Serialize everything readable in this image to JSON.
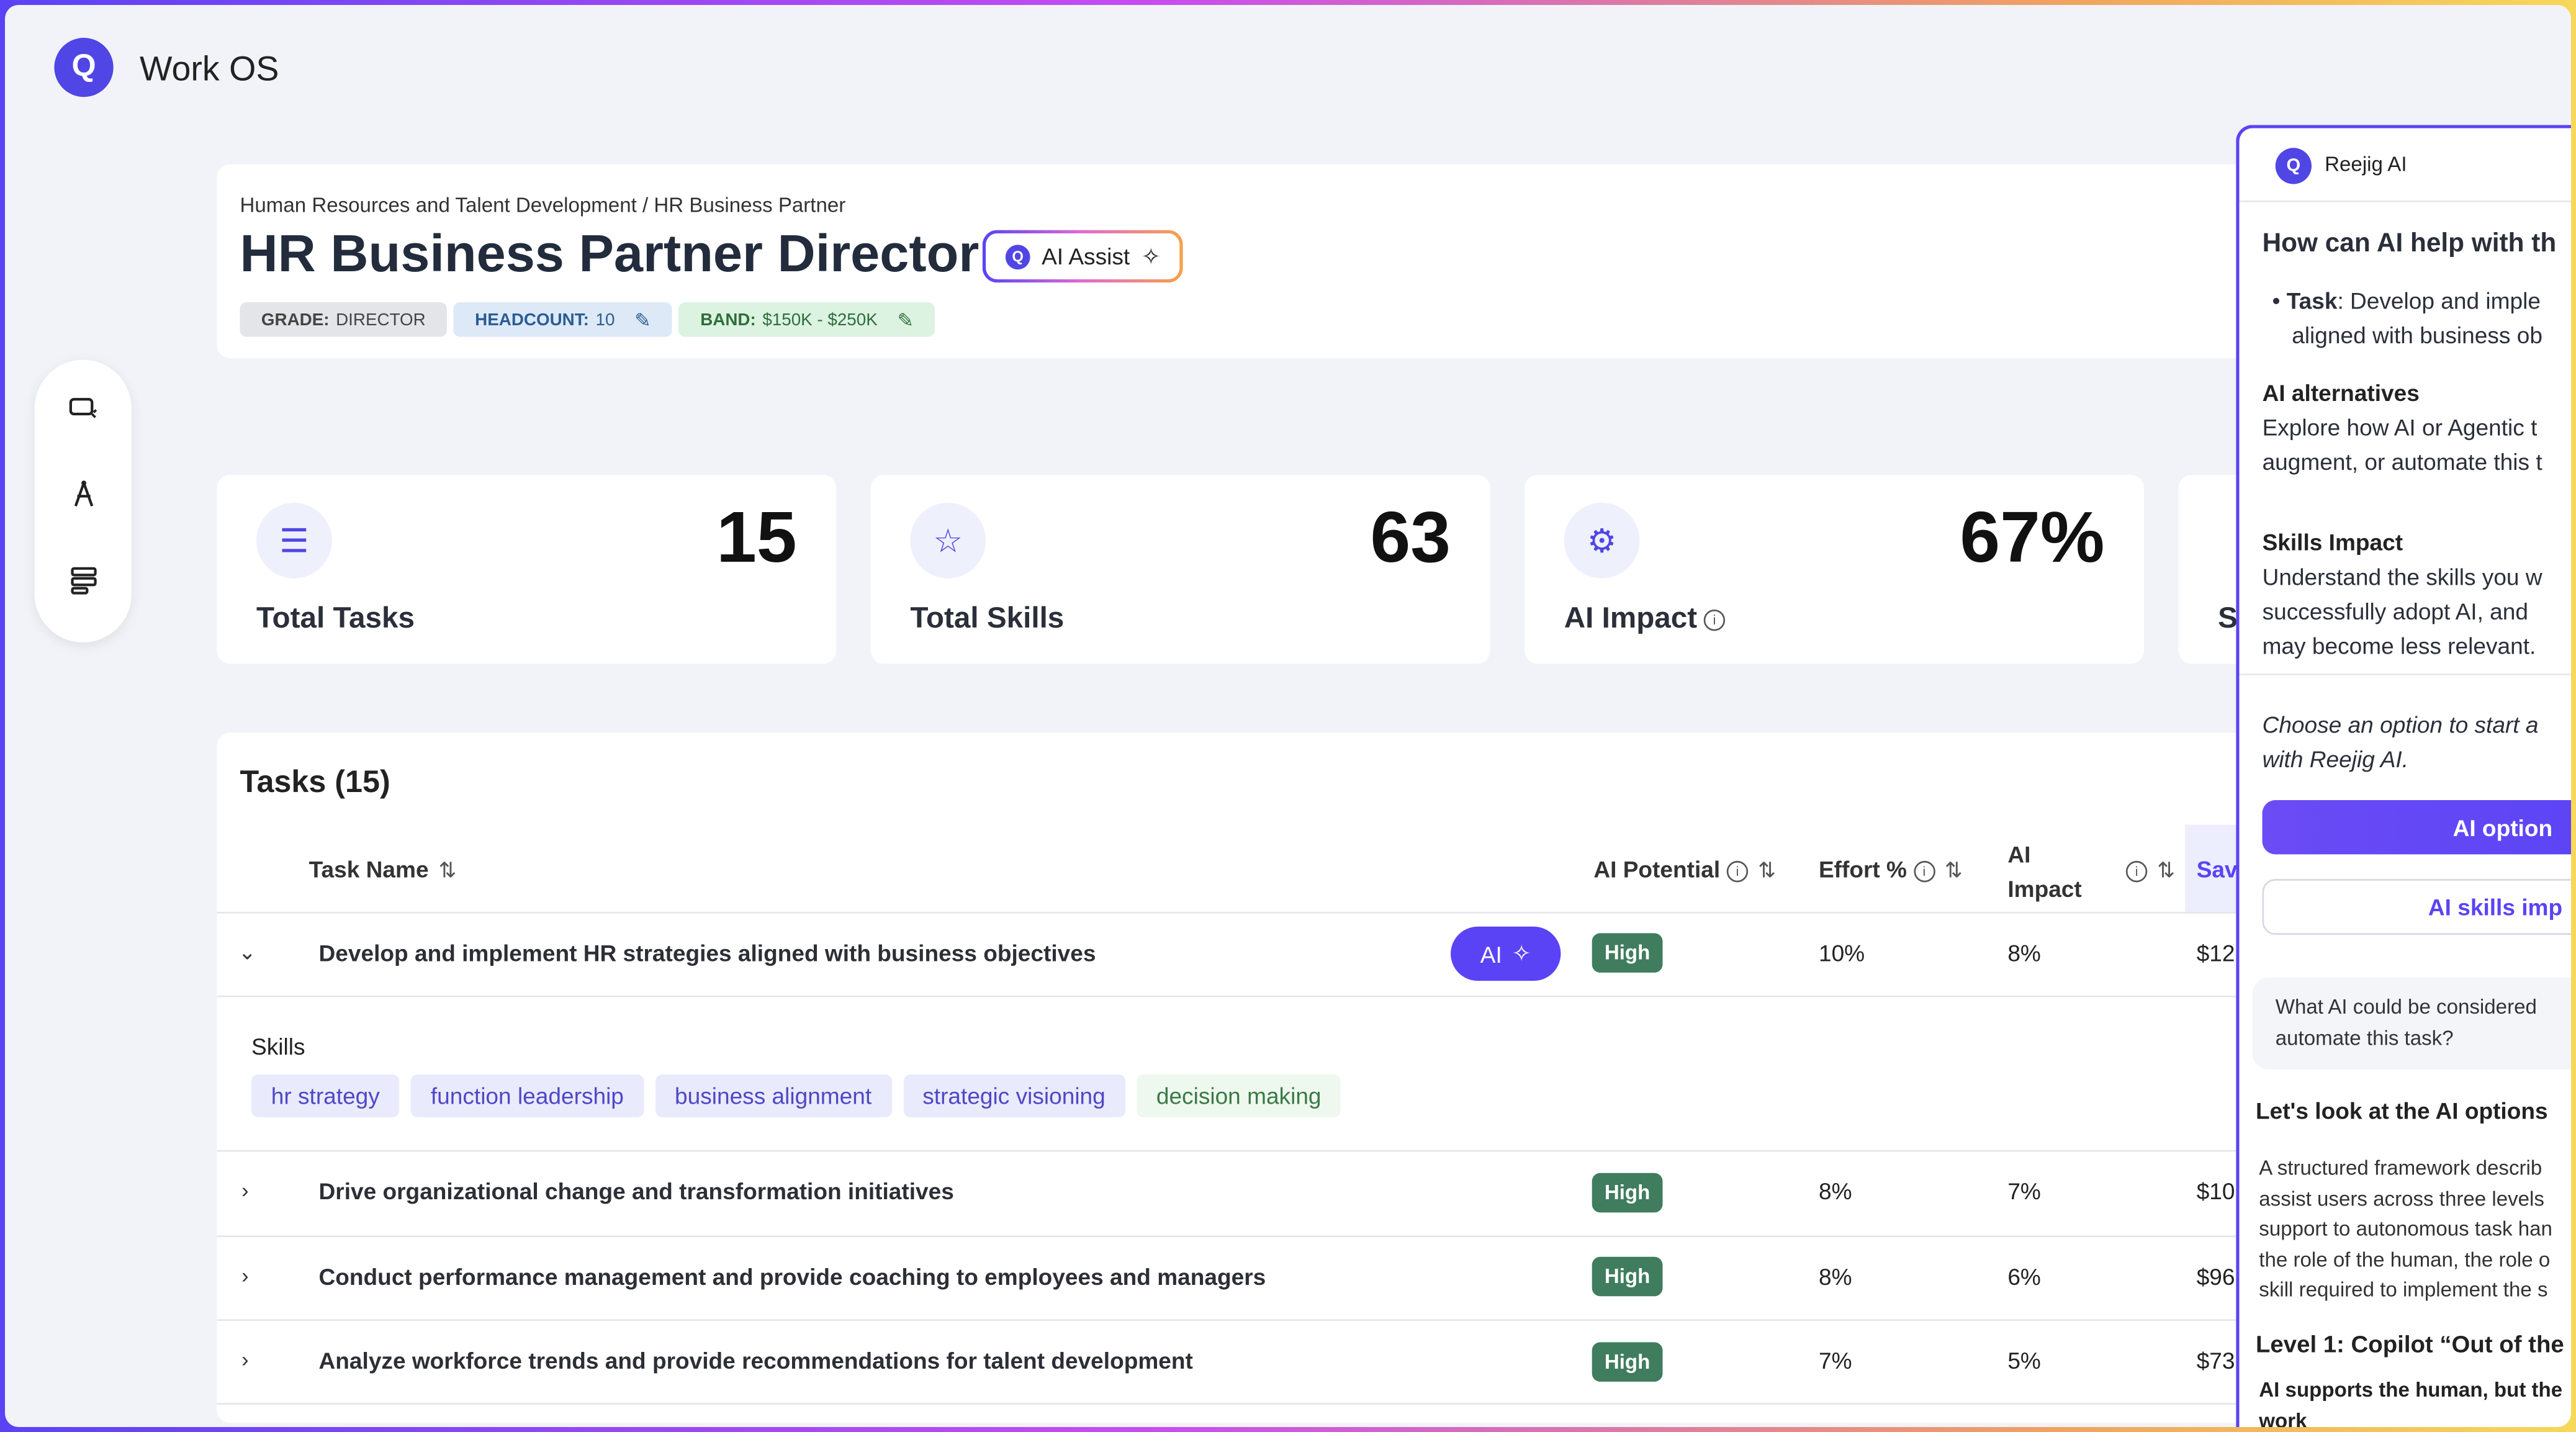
{
  "app": {
    "logo_letter": "Q",
    "name": "Work OS"
  },
  "dock": {
    "icons": [
      "chat-sparkle-icon",
      "compass-icon",
      "stack-icon"
    ]
  },
  "header": {
    "breadcrumb": "Human Resources and Talent Development / HR Business Partner",
    "title": "HR Business Partner Director",
    "ai_assist_label": "AI Assist",
    "tags": {
      "grade_key": "GRADE:",
      "grade_value": "DIRECTOR",
      "headcount_key": "HEADCOUNT:",
      "headcount_value": "10",
      "band_key": "BAND:",
      "band_value": "$150K - $250K"
    }
  },
  "stats": [
    {
      "icon": "list-icon",
      "value": "15",
      "label": "Total Tasks"
    },
    {
      "icon": "star-icon",
      "value": "63",
      "label": "Total Skills"
    },
    {
      "icon": "gear-icon",
      "value": "67%",
      "label": "AI Impact"
    },
    {
      "label": "S"
    }
  ],
  "tasks": {
    "title": "Tasks (15)",
    "columns": {
      "task_name": "Task Name",
      "ai_potential": "AI Potential",
      "effort": "Effort %",
      "ai_impact_line1": "AI",
      "ai_impact_line2": "Impact",
      "savings": "Sav"
    },
    "rows": [
      {
        "name": "Develop and implement HR strategies aligned with business objectives",
        "potential": "High",
        "effort": "10%",
        "impact": "8%",
        "savings": "$12",
        "expanded": true
      },
      {
        "name": "Drive organizational change and transformation initiatives",
        "potential": "High",
        "effort": "8%",
        "impact": "7%",
        "savings": "$10"
      },
      {
        "name": "Conduct performance management and provide coaching to employees and managers",
        "potential": "High",
        "effort": "8%",
        "impact": "6%",
        "savings": "$96"
      },
      {
        "name": "Analyze workforce trends and provide recommendations for talent development",
        "potential": "High",
        "effort": "7%",
        "impact": "5%",
        "savings": "$73"
      }
    ],
    "ai_pill_label": "AI",
    "skills_label": "Skills",
    "skills": [
      "hr strategy",
      "function leadership",
      "business alignment",
      "strategic visioning",
      "decision making"
    ]
  },
  "panel": {
    "name": "Reejig AI",
    "question": "How can AI help with th",
    "task_key": "Task",
    "task_line1": ": Develop and imple",
    "task_line2": "aligned with business ob",
    "alt_head": "AI alternatives",
    "alt_line1": "Explore how AI or Agentic t",
    "alt_line2": "augment, or automate this t",
    "skills_head": "Skills Impact",
    "skills_line1": "Understand the skills you w",
    "skills_line2": "successfully adopt AI, and",
    "skills_line3": "may become less relevant.",
    "choose_line1": "Choose an option to start a",
    "choose_line2": "with Reejig AI.",
    "btn_primary": "AI option",
    "btn_secondary": "AI skills imp",
    "quote_line1": "What AI could be considered",
    "quote_line2": "automate this task?",
    "lets_look": "Let's look at the AI options",
    "para_line1": "A structured framework describ",
    "para_line2": "assist users across three levels",
    "para_line3": "support to autonomous task han",
    "para_line4": "the role of the human, the role o",
    "para_line5": "skill required to implement the s",
    "level1": "Level 1: Copilot “Out of the",
    "level1_sub": "AI supports the human, but the",
    "level1_sub2": "work"
  },
  "colors": {
    "accent": "#5a43f5",
    "high_badge": "#3f7d5e",
    "page_bg": "#f1f3f8"
  }
}
